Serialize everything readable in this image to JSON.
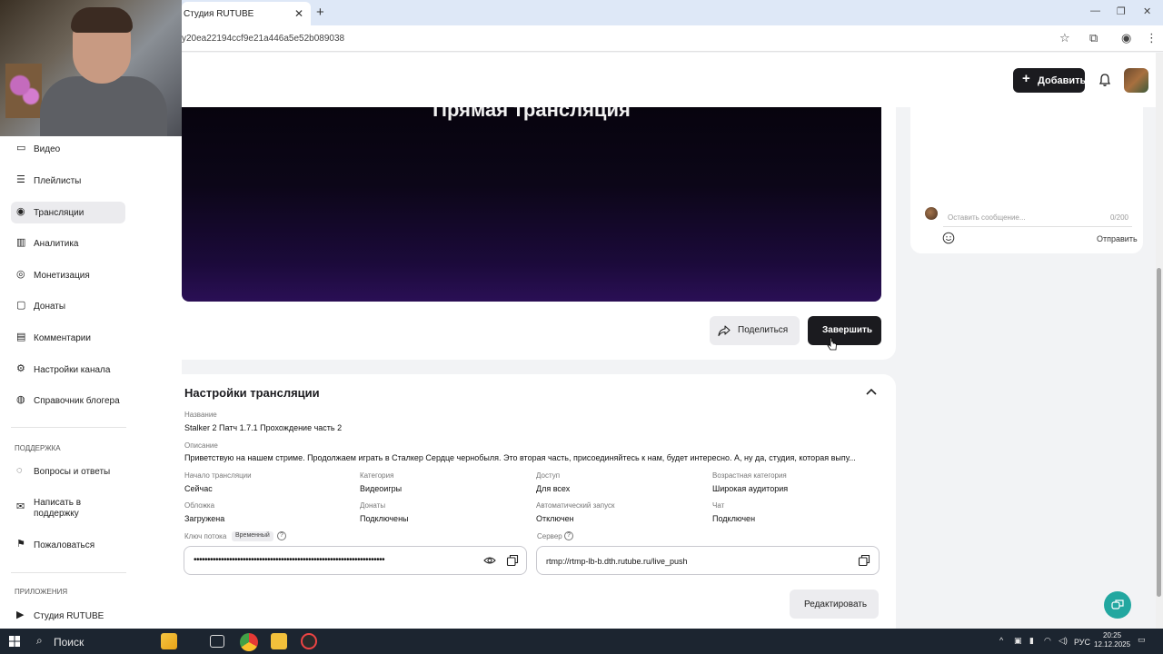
{
  "browser": {
    "tab_title": "Студия RUTUBE",
    "tab_close": "✕",
    "new_tab": "+",
    "url": "y20ea22194ccf9e21a446a5e52b089038"
  },
  "header": {
    "add_button": "Добавить"
  },
  "sidebar": {
    "items": [
      {
        "label": "Видео",
        "icon": "video-icon"
      },
      {
        "label": "Плейлисты",
        "icon": "playlist-icon"
      },
      {
        "label": "Трансляции",
        "icon": "broadcast-icon"
      },
      {
        "label": "Аналитика",
        "icon": "analytics-icon"
      },
      {
        "label": "Монетизация",
        "icon": "monetization-icon"
      },
      {
        "label": "Донаты",
        "icon": "donate-icon"
      },
      {
        "label": "Комментарии",
        "icon": "comments-icon"
      },
      {
        "label": "Настройки канала",
        "icon": "gear-icon"
      },
      {
        "label": "Справочник блогера",
        "icon": "help-icon"
      }
    ],
    "support_heading": "ПОДДЕРЖКА",
    "support_items": [
      {
        "label": "Вопросы и ответы",
        "icon": "faq-icon"
      },
      {
        "label": "Написать в поддержку",
        "icon": "mail-icon"
      },
      {
        "label": "Пожаловаться",
        "icon": "flag-icon"
      }
    ],
    "apps_heading": "ПРИЛОЖЕНИЯ",
    "apps_items": [
      {
        "label": "Студия RUTUBE",
        "icon": "studio-icon"
      }
    ],
    "active_index": 2
  },
  "player": {
    "title": "Прямая трансляция",
    "share_button": "Поделиться",
    "end_button": "Завершить"
  },
  "chat": {
    "placeholder": "Оставить сообщение...",
    "counter": "0/200",
    "send_button": "Отправить"
  },
  "settings": {
    "title": "Настройки трансляции",
    "name_label": "Название",
    "name_value": "Stalker 2 Патч 1.7.1 Прохождение часть 2",
    "description_label": "Описание",
    "description_value": "Приветствую на нашем стриме. Продолжаем играть в Сталкер Сердце чернобыля. Это вторая часть, присоединяйтесь к нам, будет интересно. А, ну да, студия, которая выпу...",
    "fields": [
      {
        "label": "Начало трансляции",
        "value": "Сейчас"
      },
      {
        "label": "Категория",
        "value": "Видеоигры"
      },
      {
        "label": "Доступ",
        "value": "Для всех"
      },
      {
        "label": "Возрастная категория",
        "value": "Широкая аудитория"
      },
      {
        "label": "Обложка",
        "value": "Загружена"
      },
      {
        "label": "Донаты",
        "value": "Подключены"
      },
      {
        "label": "Автоматический запуск",
        "value": "Отключен"
      },
      {
        "label": "Чат",
        "value": "Подключен"
      }
    ],
    "stream_key_label": "Ключ потока",
    "stream_key_badge": "Временный",
    "stream_key_value": "••••••••••••••••••••••••••••••••••••••••••••••••••••••••••••••••••••••",
    "server_label": "Сервер",
    "server_value": "rtmp://rtmp-lb-b.dth.rutube.ru/live_push",
    "edit_button": "Редактировать"
  },
  "taskbar": {
    "search_label": "Поиск",
    "language": "РУС",
    "time": "20:25",
    "date": "12.12.2025"
  },
  "colors": {
    "accent_dark": "#1b1b1f",
    "fab": "#22a7a0",
    "player_gradient_end": "#2a0f55"
  }
}
